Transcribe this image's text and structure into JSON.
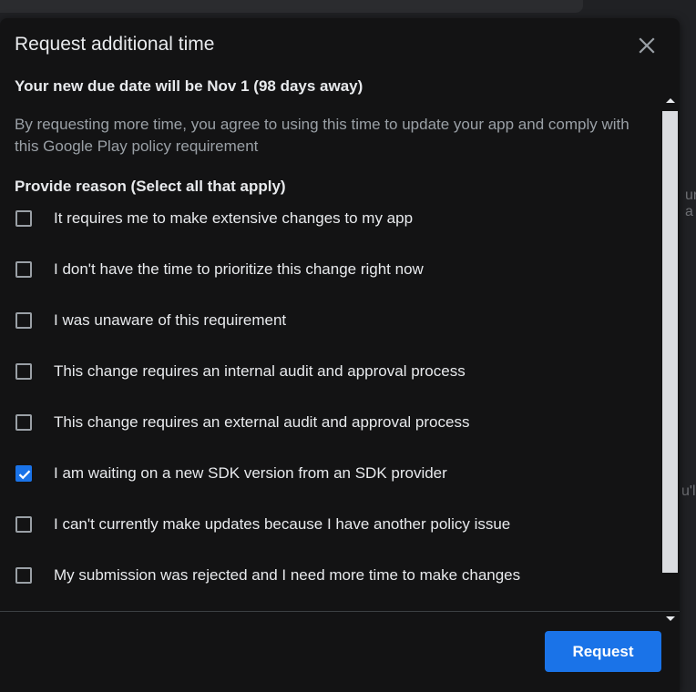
{
  "background": {
    "hint_1": "ur a",
    "hint_2": "u'll"
  },
  "dialog": {
    "title": "Request additional time",
    "close_icon": "close-icon",
    "due_date": "Your new due date will be Nov 1 (98 days away)",
    "agreement": "By requesting more time, you agree to using this time to update your app and comply with this Google Play policy requirement",
    "reason_heading": "Provide reason (Select all that apply)",
    "reasons": [
      {
        "label": "It requires me to make extensive changes to my app",
        "checked": false
      },
      {
        "label": "I don't have the time to prioritize this change right now",
        "checked": false
      },
      {
        "label": "I was unaware of this requirement",
        "checked": false
      },
      {
        "label": "This change requires an internal audit and approval process",
        "checked": false
      },
      {
        "label": "This change requires an external audit and approval process",
        "checked": false
      },
      {
        "label": "I am waiting on a new SDK version from an SDK provider",
        "checked": true
      },
      {
        "label": "I can't currently make updates because I have another policy issue",
        "checked": false
      },
      {
        "label": "My submission was rejected and I need more time to make changes",
        "checked": false
      }
    ],
    "request_label": "Request"
  },
  "colors": {
    "accent": "#1a73e8",
    "dialog_bg": "#131314",
    "text_primary": "#e8eaed",
    "text_secondary": "#9aa0a6"
  }
}
